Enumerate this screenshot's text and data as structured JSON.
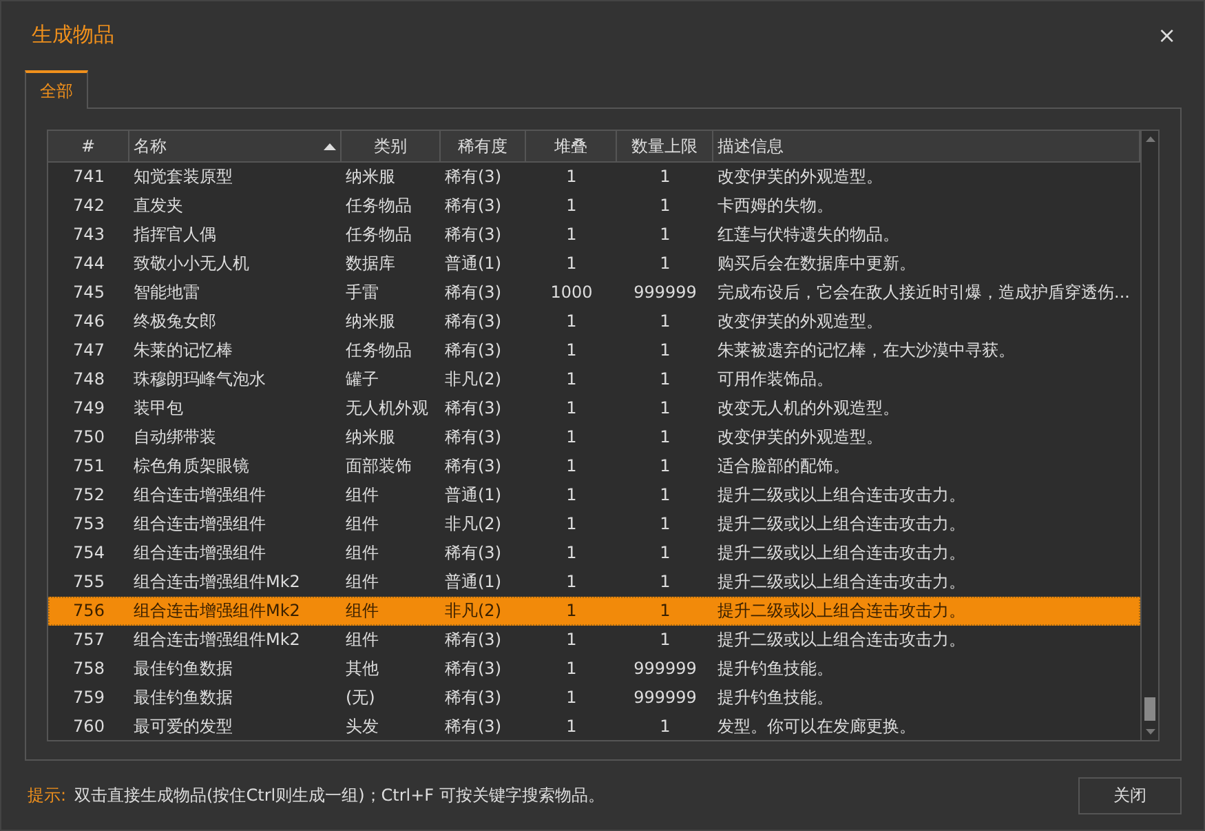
{
  "window": {
    "title": "生成物品",
    "close": "×"
  },
  "tabs": [
    {
      "label": "全部",
      "selected": true
    }
  ],
  "table": {
    "columns": [
      {
        "label": "#",
        "sorted": false
      },
      {
        "label": "名称",
        "sorted": true
      },
      {
        "label": "类别",
        "sorted": false
      },
      {
        "label": "稀有度",
        "sorted": false
      },
      {
        "label": "堆叠",
        "sorted": false
      },
      {
        "label": "数量上限",
        "sorted": false
      },
      {
        "label": "描述信息",
        "sorted": false
      }
    ],
    "rows": [
      {
        "cells": [
          "741",
          "知觉套装原型",
          "纳米服",
          "稀有(3)",
          "1",
          "1",
          "改变伊芙的外观造型。"
        ],
        "selected": false
      },
      {
        "cells": [
          "742",
          "直发夹",
          "任务物品",
          "稀有(3)",
          "1",
          "1",
          "卡西姆的失物。"
        ],
        "selected": false
      },
      {
        "cells": [
          "743",
          "指挥官人偶",
          "任务物品",
          "稀有(3)",
          "1",
          "1",
          "红莲与伏特遗失的物品。"
        ],
        "selected": false
      },
      {
        "cells": [
          "744",
          "致敬小小无人机",
          "数据库",
          "普通(1)",
          "1",
          "1",
          "购买后会在数据库中更新。"
        ],
        "selected": false
      },
      {
        "cells": [
          "745",
          "智能地雷",
          "手雷",
          "稀有(3)",
          "1000",
          "999999",
          "完成布设后，它会在敌人接近时引爆，造成护盾穿透伤..."
        ],
        "selected": false
      },
      {
        "cells": [
          "746",
          "终极兔女郎",
          "纳米服",
          "稀有(3)",
          "1",
          "1",
          "改变伊芙的外观造型。"
        ],
        "selected": false
      },
      {
        "cells": [
          "747",
          "朱莱的记忆棒",
          "任务物品",
          "稀有(3)",
          "1",
          "1",
          "朱莱被遗弃的记忆棒，在大沙漠中寻获。"
        ],
        "selected": false
      },
      {
        "cells": [
          "748",
          "珠穆朗玛峰气泡水",
          "罐子",
          "非凡(2)",
          "1",
          "1",
          "可用作装饰品。"
        ],
        "selected": false
      },
      {
        "cells": [
          "749",
          "装甲包",
          "无人机外观",
          "稀有(3)",
          "1",
          "1",
          "改变无人机的外观造型。"
        ],
        "selected": false
      },
      {
        "cells": [
          "750",
          "自动绑带装",
          "纳米服",
          "稀有(3)",
          "1",
          "1",
          "改变伊芙的外观造型。"
        ],
        "selected": false
      },
      {
        "cells": [
          "751",
          "棕色角质架眼镜",
          "面部装饰",
          "稀有(3)",
          "1",
          "1",
          "适合脸部的配饰。"
        ],
        "selected": false
      },
      {
        "cells": [
          "752",
          "组合连击增强组件",
          "组件",
          "普通(1)",
          "1",
          "1",
          "提升二级或以上组合连击攻击力。"
        ],
        "selected": false
      },
      {
        "cells": [
          "753",
          "组合连击增强组件",
          "组件",
          "非凡(2)",
          "1",
          "1",
          "提升二级或以上组合连击攻击力。"
        ],
        "selected": false
      },
      {
        "cells": [
          "754",
          "组合连击增强组件",
          "组件",
          "稀有(3)",
          "1",
          "1",
          "提升二级或以上组合连击攻击力。"
        ],
        "selected": false
      },
      {
        "cells": [
          "755",
          "组合连击增强组件Mk2",
          "组件",
          "普通(1)",
          "1",
          "1",
          "提升二级或以上组合连击攻击力。"
        ],
        "selected": false
      },
      {
        "cells": [
          "756",
          "组合连击增强组件Mk2",
          "组件",
          "非凡(2)",
          "1",
          "1",
          "提升二级或以上组合连击攻击力。"
        ],
        "selected": true
      },
      {
        "cells": [
          "757",
          "组合连击增强组件Mk2",
          "组件",
          "稀有(3)",
          "1",
          "1",
          "提升二级或以上组合连击攻击力。"
        ],
        "selected": false
      },
      {
        "cells": [
          "758",
          "最佳钓鱼数据",
          "其他",
          "稀有(3)",
          "1",
          "999999",
          "提升钓鱼技能。"
        ],
        "selected": false
      },
      {
        "cells": [
          "759",
          "最佳钓鱼数据",
          "(无)",
          "稀有(3)",
          "1",
          "999999",
          "提升钓鱼技能。"
        ],
        "selected": false
      },
      {
        "cells": [
          "760",
          "最可爱的发型",
          "头发",
          "稀有(3)",
          "1",
          "1",
          "发型。你可以在发廊更换。"
        ],
        "selected": false
      }
    ]
  },
  "footer": {
    "hint_label": "提示:",
    "hint": "双击直接生成物品(按住Ctrl则生成一组)；Ctrl+F 可按关键字搜索物品。",
    "buttons": [
      "关闭"
    ]
  }
}
